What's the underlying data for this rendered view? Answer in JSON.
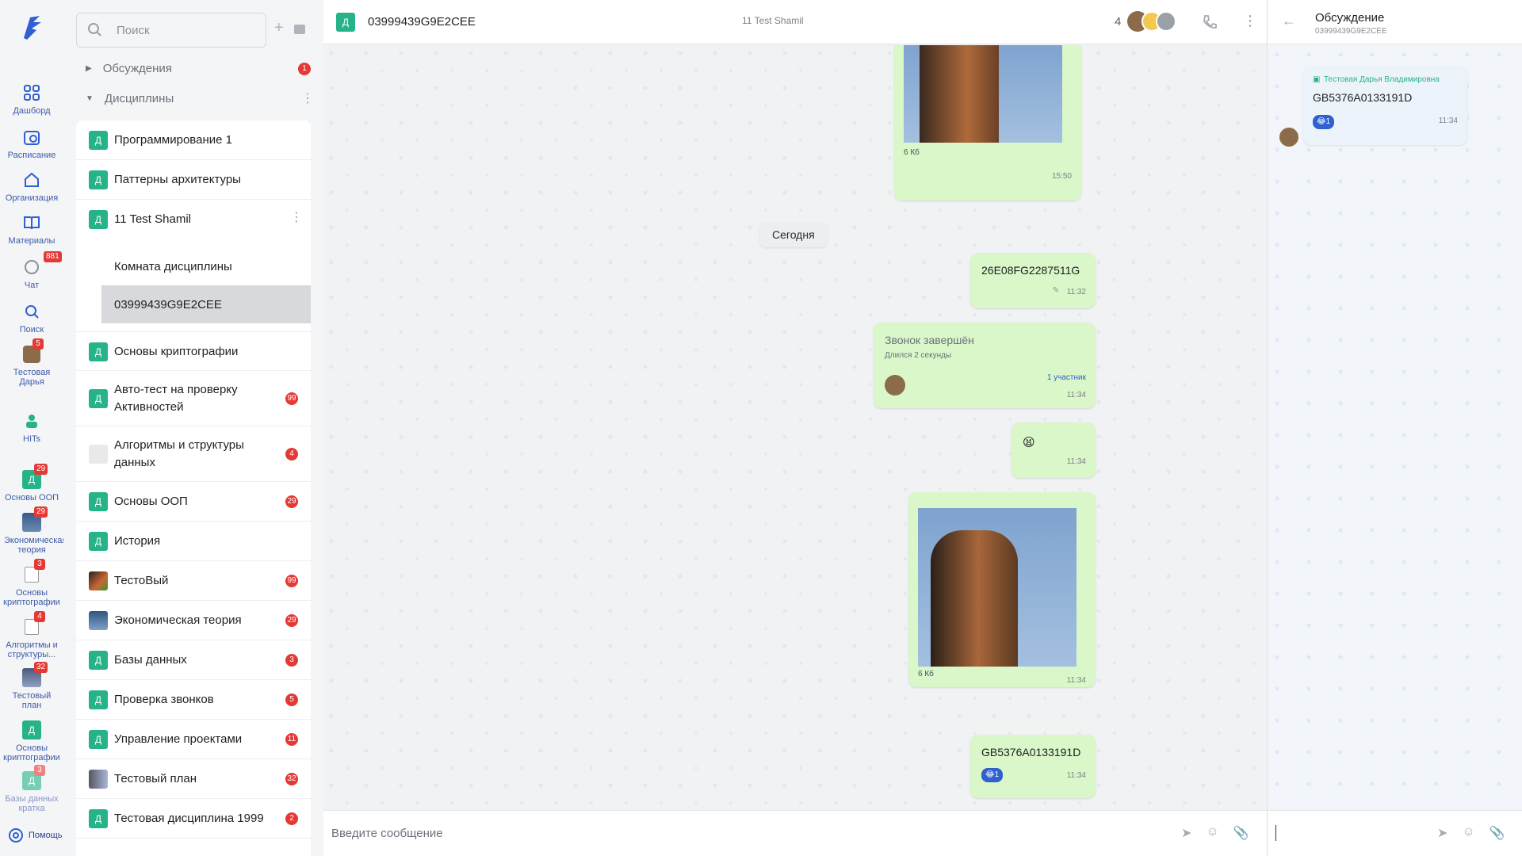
{
  "nav": {
    "items": [
      {
        "label": "Дашборд",
        "icon": "dashboard-icon"
      },
      {
        "label": "Расписание",
        "icon": "calendar-icon"
      },
      {
        "label": "Организация",
        "icon": "home-icon"
      },
      {
        "label": "Материалы",
        "icon": "book-icon"
      },
      {
        "label": "Чат",
        "icon": "chat-icon",
        "badge": "881"
      },
      {
        "label": "Поиск",
        "icon": "search-icon"
      },
      {
        "label": "Тестовая Дарья",
        "icon": "avatar",
        "badge": "5"
      },
      {
        "label": "HITs",
        "icon": "hits-icon"
      },
      {
        "label": "Основы ООП",
        "icon": "д",
        "badge": "29"
      },
      {
        "label": "Экономическая теория",
        "icon": "image",
        "badge": "29"
      },
      {
        "label": "Основы криптографии",
        "icon": "doc",
        "badge": "3"
      },
      {
        "label": "Алгоритмы и структуры...",
        "icon": "doc",
        "badge": "4"
      },
      {
        "label": "Тестовый план",
        "icon": "image",
        "badge": "32"
      },
      {
        "label": "Основы криптографии",
        "icon": "д"
      },
      {
        "label": "Базы данных кратка",
        "icon": "д",
        "badge": "3"
      }
    ],
    "help_label": "Помощь"
  },
  "sidebar": {
    "search_placeholder": "Поиск",
    "groups": [
      {
        "label": "Обсуждения",
        "badge": "1"
      },
      {
        "label": "Дисциплины"
      }
    ],
    "avatar_letter": "Д",
    "rows": [
      {
        "name": "Программирование 1",
        "badge": ""
      },
      {
        "name": "Паттерны архитектуры",
        "badge": ""
      },
      {
        "name": "11 Test Shamil",
        "badge": ""
      },
      {
        "name": "Основы криптографии",
        "badge": ""
      },
      {
        "name": "Авто-тест на проверку Активностей",
        "badge": "99"
      },
      {
        "name": "Алгоритмы и структуры данных",
        "badge": "4"
      },
      {
        "name": "Основы ООП",
        "badge": "29"
      },
      {
        "name": "История",
        "badge": ""
      },
      {
        "name": "ТестоВый",
        "badge": "99"
      },
      {
        "name": "Экономическая теория",
        "badge": "29"
      },
      {
        "name": "Базы данных",
        "badge": "3"
      },
      {
        "name": "Проверка звонков",
        "badge": "5"
      },
      {
        "name": "Управление проектами",
        "badge": "11"
      },
      {
        "name": "Тестовый план",
        "badge": "32"
      },
      {
        "name": "Тестовая дисциплина 1999",
        "badge": "2"
      }
    ],
    "subrows": [
      {
        "name": "Комната дисциплины"
      },
      {
        "name": "03999439G9E2CEE"
      }
    ]
  },
  "chat": {
    "title": "03999439G9E2CEE",
    "subtitle": "11 Test Shamil",
    "members_count": "4",
    "day_separator": "Сегодня",
    "messages": {
      "m1": {
        "size": "6 Кб",
        "time": "15:50"
      },
      "m2": {
        "text": "26E08FG2287511G",
        "time": "11:32"
      },
      "m3": {
        "title": "Звонок завершён",
        "duration": "Длился 2 секунды",
        "participants": "1 участник",
        "time": "11:34"
      },
      "m4": {
        "emoji": "😫",
        "time": "11:34"
      },
      "m5": {
        "size": "6 Кб",
        "time": "11:34"
      },
      "m6": {
        "text": "GB5376A0133191D",
        "reaction": "😂1",
        "time": "11:34"
      }
    },
    "composer_placeholder": "Введите сообщение"
  },
  "thread": {
    "title": "Обсуждение",
    "subtitle": "03999439G9E2CEE",
    "message": {
      "author": "Тестовая Дарья Владимировна",
      "text": "GB5376A0133191D",
      "reaction": "😂1",
      "time": "11:34"
    }
  },
  "colors": {
    "accent": "#26b38a",
    "bubble": "#d9f7c9",
    "badge": "#e53935",
    "brand": "#3d5aa8"
  }
}
